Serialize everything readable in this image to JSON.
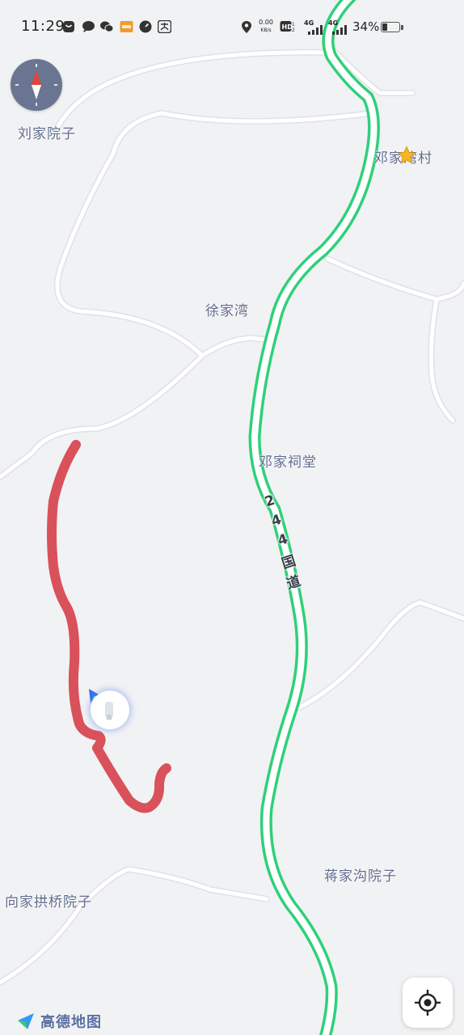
{
  "status_bar": {
    "time": "11:29",
    "net_speed_value": "0.00",
    "net_speed_unit": "KB/s",
    "hd_label": "HD",
    "sim1_type": "4G",
    "sim2_type": "4G",
    "battery_percent": "34%",
    "battery_level": 0.34
  },
  "places": [
    {
      "id": "liujia",
      "name": "刘家院子"
    },
    {
      "id": "dengjia-village",
      "name": "邓家湾村"
    },
    {
      "id": "xujia",
      "name": "徐家湾"
    },
    {
      "id": "dengjia-ancestral",
      "name": "邓家祠堂"
    },
    {
      "id": "jiangjia",
      "name": "蒋家沟院子"
    },
    {
      "id": "xiangjia",
      "name": "向家拱桥院子"
    }
  ],
  "road_label_chars": [
    "2",
    "4",
    "4",
    "国",
    "道"
  ],
  "colors": {
    "map_background": "#f1f2f4",
    "minor_road": "#ffffff",
    "highway": "#2fd07a",
    "track": "#d9515a",
    "place_label": "#5f6b8e",
    "compass_bg": "#6a7691",
    "compass_north": "#e2433c"
  },
  "icons": {
    "compass": "compass-icon",
    "locate": "crosshair-icon",
    "favorite": "star-icon",
    "logo": "gaode-logo-icon"
  },
  "branding": {
    "logo_text": "高德地图"
  }
}
